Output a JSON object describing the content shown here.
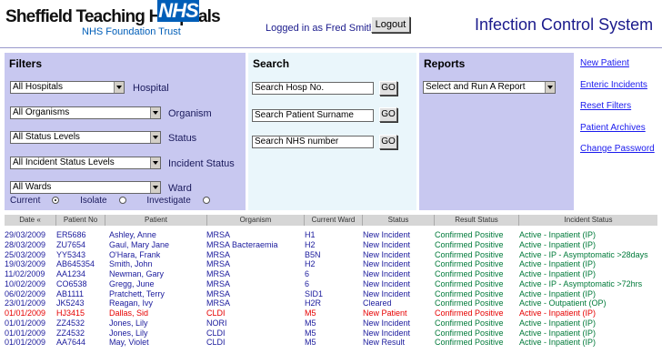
{
  "header": {
    "brand_name": "Sheffield Teaching Hospitals",
    "nhs_logo_text": "NHS",
    "trust_name": "NHS Foundation Trust",
    "logged_in_text": "Logged in as Fred Smith",
    "logout_label": "Logout",
    "app_title": "Infection Control System",
    "nhs_color": "#005eb8"
  },
  "filters": {
    "title": "Filters",
    "hospital": {
      "value": "All Hospitals",
      "label": "Hospital"
    },
    "organism": {
      "value": "All Organisms",
      "label": "Organism"
    },
    "status": {
      "value": "All Status Levels",
      "label": "Status"
    },
    "incident_status": {
      "value": "All Incident Status Levels",
      "label": "Incident Status"
    },
    "ward": {
      "value": "All Wards",
      "label": "Ward"
    },
    "radios": [
      {
        "label": "Current",
        "checked": true
      },
      {
        "label": "Isolate",
        "checked": false
      },
      {
        "label": "Investigate",
        "checked": false
      }
    ]
  },
  "search": {
    "title": "Search",
    "fields": [
      {
        "placeholder": "Search Hosp No.",
        "go_label": "GO"
      },
      {
        "placeholder": "Search Patient Surname",
        "go_label": "GO"
      },
      {
        "placeholder": "Search NHS number",
        "go_label": "GO"
      }
    ]
  },
  "reports": {
    "title": "Reports",
    "select_value": "Select and Run A Report"
  },
  "links": [
    "New Patient",
    "Enteric Incidents",
    "Reset Filters",
    "Patient Archives",
    "Change Password"
  ],
  "table": {
    "columns": [
      "Date",
      "Patient No",
      "Patient",
      "Organism",
      "Current Ward",
      "Status",
      "Result Status",
      "Incident Status"
    ],
    "sort_indicator": "«",
    "rows": [
      {
        "date": "29/03/2009",
        "patient_no": "ER5686",
        "patient": "Ashley, Anne",
        "organism": "MRSA",
        "ward": "H1",
        "status": "New Incident",
        "result": "Confirmed Positive",
        "incident": "Active - Inpatient (IP)",
        "highlight": false
      },
      {
        "date": "28/03/2009",
        "patient_no": "ZU7654",
        "patient": "Gaul, Mary Jane",
        "organism": "MRSA Bacteraemia",
        "ward": "H2",
        "status": "New Incident",
        "result": "Confirmed Positive",
        "incident": "Active - Inpatient (IP)",
        "highlight": false
      },
      {
        "date": "25/03/2009",
        "patient_no": "YY5343",
        "patient": "O'Hara, Frank",
        "organism": "MRSA",
        "ward": "B5N",
        "status": "New Incident",
        "result": "Confirmed Positive",
        "incident": "Active - IP - Asymptomatic >28days",
        "highlight": false
      },
      {
        "date": "19/03/2009",
        "patient_no": "AB645354",
        "patient": "Smith, John",
        "organism": "MRSA",
        "ward": "H2",
        "status": "New Incident",
        "result": "Confirmed Positive",
        "incident": "Active - Inpatient (IP)",
        "highlight": false
      },
      {
        "date": "11/02/2009",
        "patient_no": "AA1234",
        "patient": "Newman, Gary",
        "organism": "MRSA",
        "ward": "6",
        "status": "New Incident",
        "result": "Confirmed Positive",
        "incident": "Active - Inpatient (IP)",
        "highlight": false
      },
      {
        "date": "10/02/2009",
        "patient_no": "CO6538",
        "patient": "Gregg, June",
        "organism": "MRSA",
        "ward": "6",
        "status": "New Incident",
        "result": "Confirmed Positive",
        "incident": "Active - IP - Asymptomatic >72hrs",
        "highlight": false
      },
      {
        "date": "06/02/2009",
        "patient_no": "AB1111",
        "patient": "Pratchett, Terry",
        "organism": "MRSA",
        "ward": "SID1",
        "status": "New Incident",
        "result": "Confirmed Positive",
        "incident": "Active - Inpatient (IP)",
        "highlight": false
      },
      {
        "date": "23/01/2009",
        "patient_no": "JK5243",
        "patient": "Reagan, Ivy",
        "organism": "MRSA",
        "ward": "H2R",
        "status": "Cleared",
        "result": "Confirmed Positive",
        "incident": "Active - Outpatient (OP)",
        "highlight": false
      },
      {
        "date": "01/01/2009",
        "patient_no": "HJ3415",
        "patient": "Dallas, Sid",
        "organism": "CLDI",
        "ward": "M5",
        "status": "New Patient",
        "result": "Confirmed Positive",
        "incident": "Active - Inpatient (IP)",
        "highlight": true
      },
      {
        "date": "01/01/2009",
        "patient_no": "ZZ4532",
        "patient": "Jones, Lily",
        "organism": "NORI",
        "ward": "M5",
        "status": "New Incident",
        "result": "Confirmed Positive",
        "incident": "Active - Inpatient (IP)",
        "highlight": false
      },
      {
        "date": "01/01/2009",
        "patient_no": "ZZ4532",
        "patient": "Jones, Lily",
        "organism": "CLDI",
        "ward": "M5",
        "status": "New Incident",
        "result": "Confirmed Positive",
        "incident": "Active - Inpatient (IP)",
        "highlight": false
      },
      {
        "date": "01/01/2009",
        "patient_no": "AA7644",
        "patient": "May, Violet",
        "organism": "CLDI",
        "ward": "M5",
        "status": "New Result",
        "result": "Confirmed Positive",
        "incident": "Active - Inpatient (IP)",
        "highlight": false
      }
    ]
  }
}
